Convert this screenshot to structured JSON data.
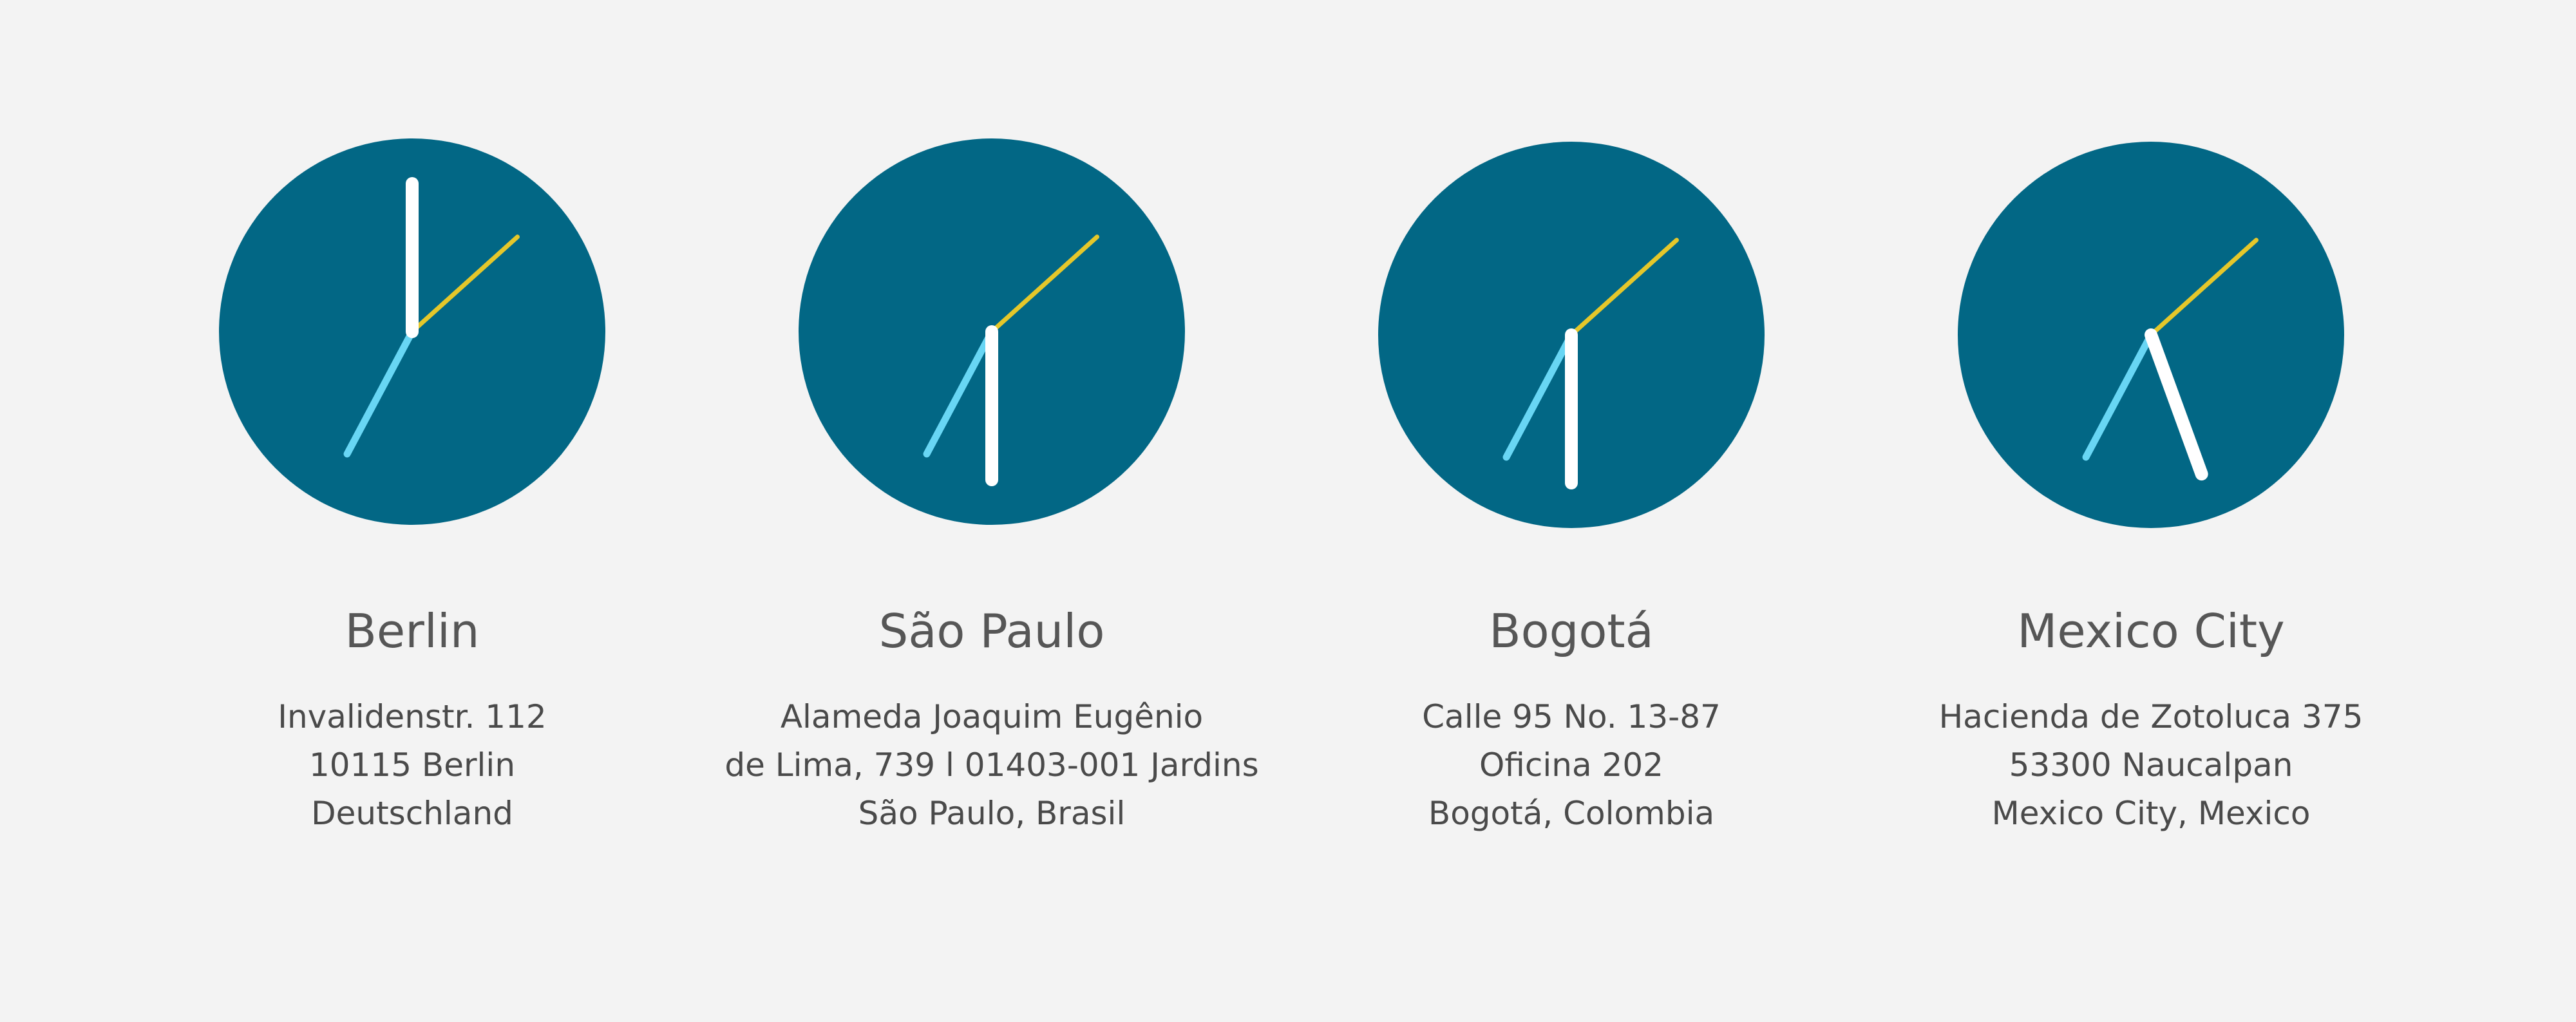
{
  "colors": {
    "background": "#f3f3f3",
    "clock_face": "#026785",
    "hour_hand": "#ffffff",
    "minute_hand": "#68d6f4",
    "second_hand": "#e5c72a"
  },
  "offices": [
    {
      "city": "Berlin",
      "address": [
        "Invalidenstr. 112",
        "10115 Berlin",
        "Deutschland"
      ],
      "clock": {
        "hour_angle": 0,
        "minute_angle": 208,
        "second_angle": 48
      }
    },
    {
      "city": "São Paulo",
      "address": [
        "Alameda Joaquim Eugênio",
        "de Lima, 739 l 01403-001 Jardins",
        "São Paulo, Brasil"
      ],
      "clock": {
        "hour_angle": 180,
        "minute_angle": 208,
        "second_angle": 48
      }
    },
    {
      "city": "Bogotá",
      "address": [
        "Calle 95 No. 13-87",
        "Oficina 202",
        "Bogotá, Colombia"
      ],
      "clock": {
        "hour_angle": 180,
        "minute_angle": 208,
        "second_angle": 48
      }
    },
    {
      "city": "Mexico City",
      "address": [
        "Hacienda de Zotoluca 375",
        "53300 Naucalpan",
        "Mexico City, Mexico"
      ],
      "clock": {
        "hour_angle": 160,
        "minute_angle": 208,
        "second_angle": 48
      }
    }
  ]
}
